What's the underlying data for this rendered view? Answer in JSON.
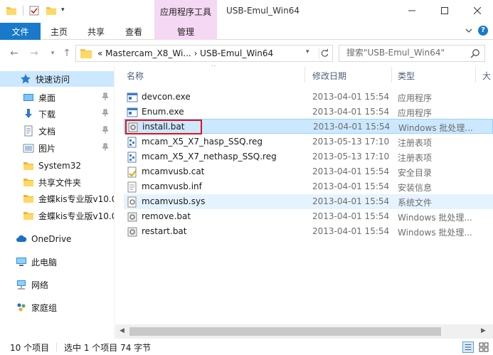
{
  "window": {
    "title": "USB-Emul_Win64",
    "context_tab_header": "应用程序工具"
  },
  "ribbon": {
    "tabs": [
      "文件",
      "主页",
      "共享",
      "查看",
      "管理"
    ]
  },
  "address": {
    "path": "«  Mastercam_X8_Wi...  ›  USB-Emul_Win64",
    "search_placeholder": "搜索\"USB-Emul_Win64\""
  },
  "nav_pane": {
    "items": [
      {
        "label": "快速访问",
        "icon": "star-icon"
      },
      {
        "label": "桌面",
        "icon": "desktop-icon"
      },
      {
        "label": "下载",
        "icon": "download-icon"
      },
      {
        "label": "文档",
        "icon": "document-icon"
      },
      {
        "label": "图片",
        "icon": "picture-icon"
      },
      {
        "label": "System32",
        "icon": "folder-icon"
      },
      {
        "label": "共享文件夹",
        "icon": "folder-icon"
      },
      {
        "label": "金蝶kis专业版v10.0",
        "icon": "folder-icon"
      },
      {
        "label": "金蝶kis专业版v10.0",
        "icon": "folder-icon"
      },
      {
        "label": "OneDrive",
        "icon": "cloud-icon"
      },
      {
        "label": "此电脑",
        "icon": "computer-icon"
      },
      {
        "label": "网络",
        "icon": "network-icon"
      },
      {
        "label": "家庭组",
        "icon": "homegroup-icon"
      }
    ]
  },
  "file_list": {
    "columns": {
      "name": "名称",
      "date": "修改日期",
      "type": "类型",
      "size": "大"
    },
    "files": [
      {
        "name": "devcon.exe",
        "date": "2013-04-01 15:54",
        "type": "应用程序",
        "icon": "exe-icon"
      },
      {
        "name": "Enum.exe",
        "date": "2013-04-01 15:54",
        "type": "应用程序",
        "icon": "exe-icon"
      },
      {
        "name": "install.bat",
        "date": "2013-04-01 15:54",
        "type": "Windows 批处理...",
        "icon": "bat-icon"
      },
      {
        "name": "mcam_X5_X7_hasp_SSQ.reg",
        "date": "2013-05-13 17:10",
        "type": "注册表项",
        "icon": "reg-icon"
      },
      {
        "name": "mcam_X5_X7_nethasp_SSQ.reg",
        "date": "2013-05-13 17:10",
        "type": "注册表项",
        "icon": "reg-icon"
      },
      {
        "name": "mcamvusb.cat",
        "date": "2013-04-01 15:54",
        "type": "安全目录",
        "icon": "cat-icon"
      },
      {
        "name": "mcamvusb.inf",
        "date": "2013-04-01 15:54",
        "type": "安装信息",
        "icon": "inf-icon"
      },
      {
        "name": "mcamvusb.sys",
        "date": "2013-04-01 15:54",
        "type": "系统文件",
        "icon": "sys-icon"
      },
      {
        "name": "remove.bat",
        "date": "2013-04-01 15:54",
        "type": "Windows 批处理...",
        "icon": "bat-icon"
      },
      {
        "name": "restart.bat",
        "date": "2013-04-01 15:54",
        "type": "Windows 批处理...",
        "icon": "bat-icon"
      }
    ]
  },
  "status": {
    "count": "10 个项目",
    "selected": "选中 1 个项目  74 字节"
  },
  "colors": {
    "accent": "#1979ca",
    "context_tab": "#f5d8f3",
    "selection": "#cce8ff",
    "highlight_box": "#d8151b"
  }
}
